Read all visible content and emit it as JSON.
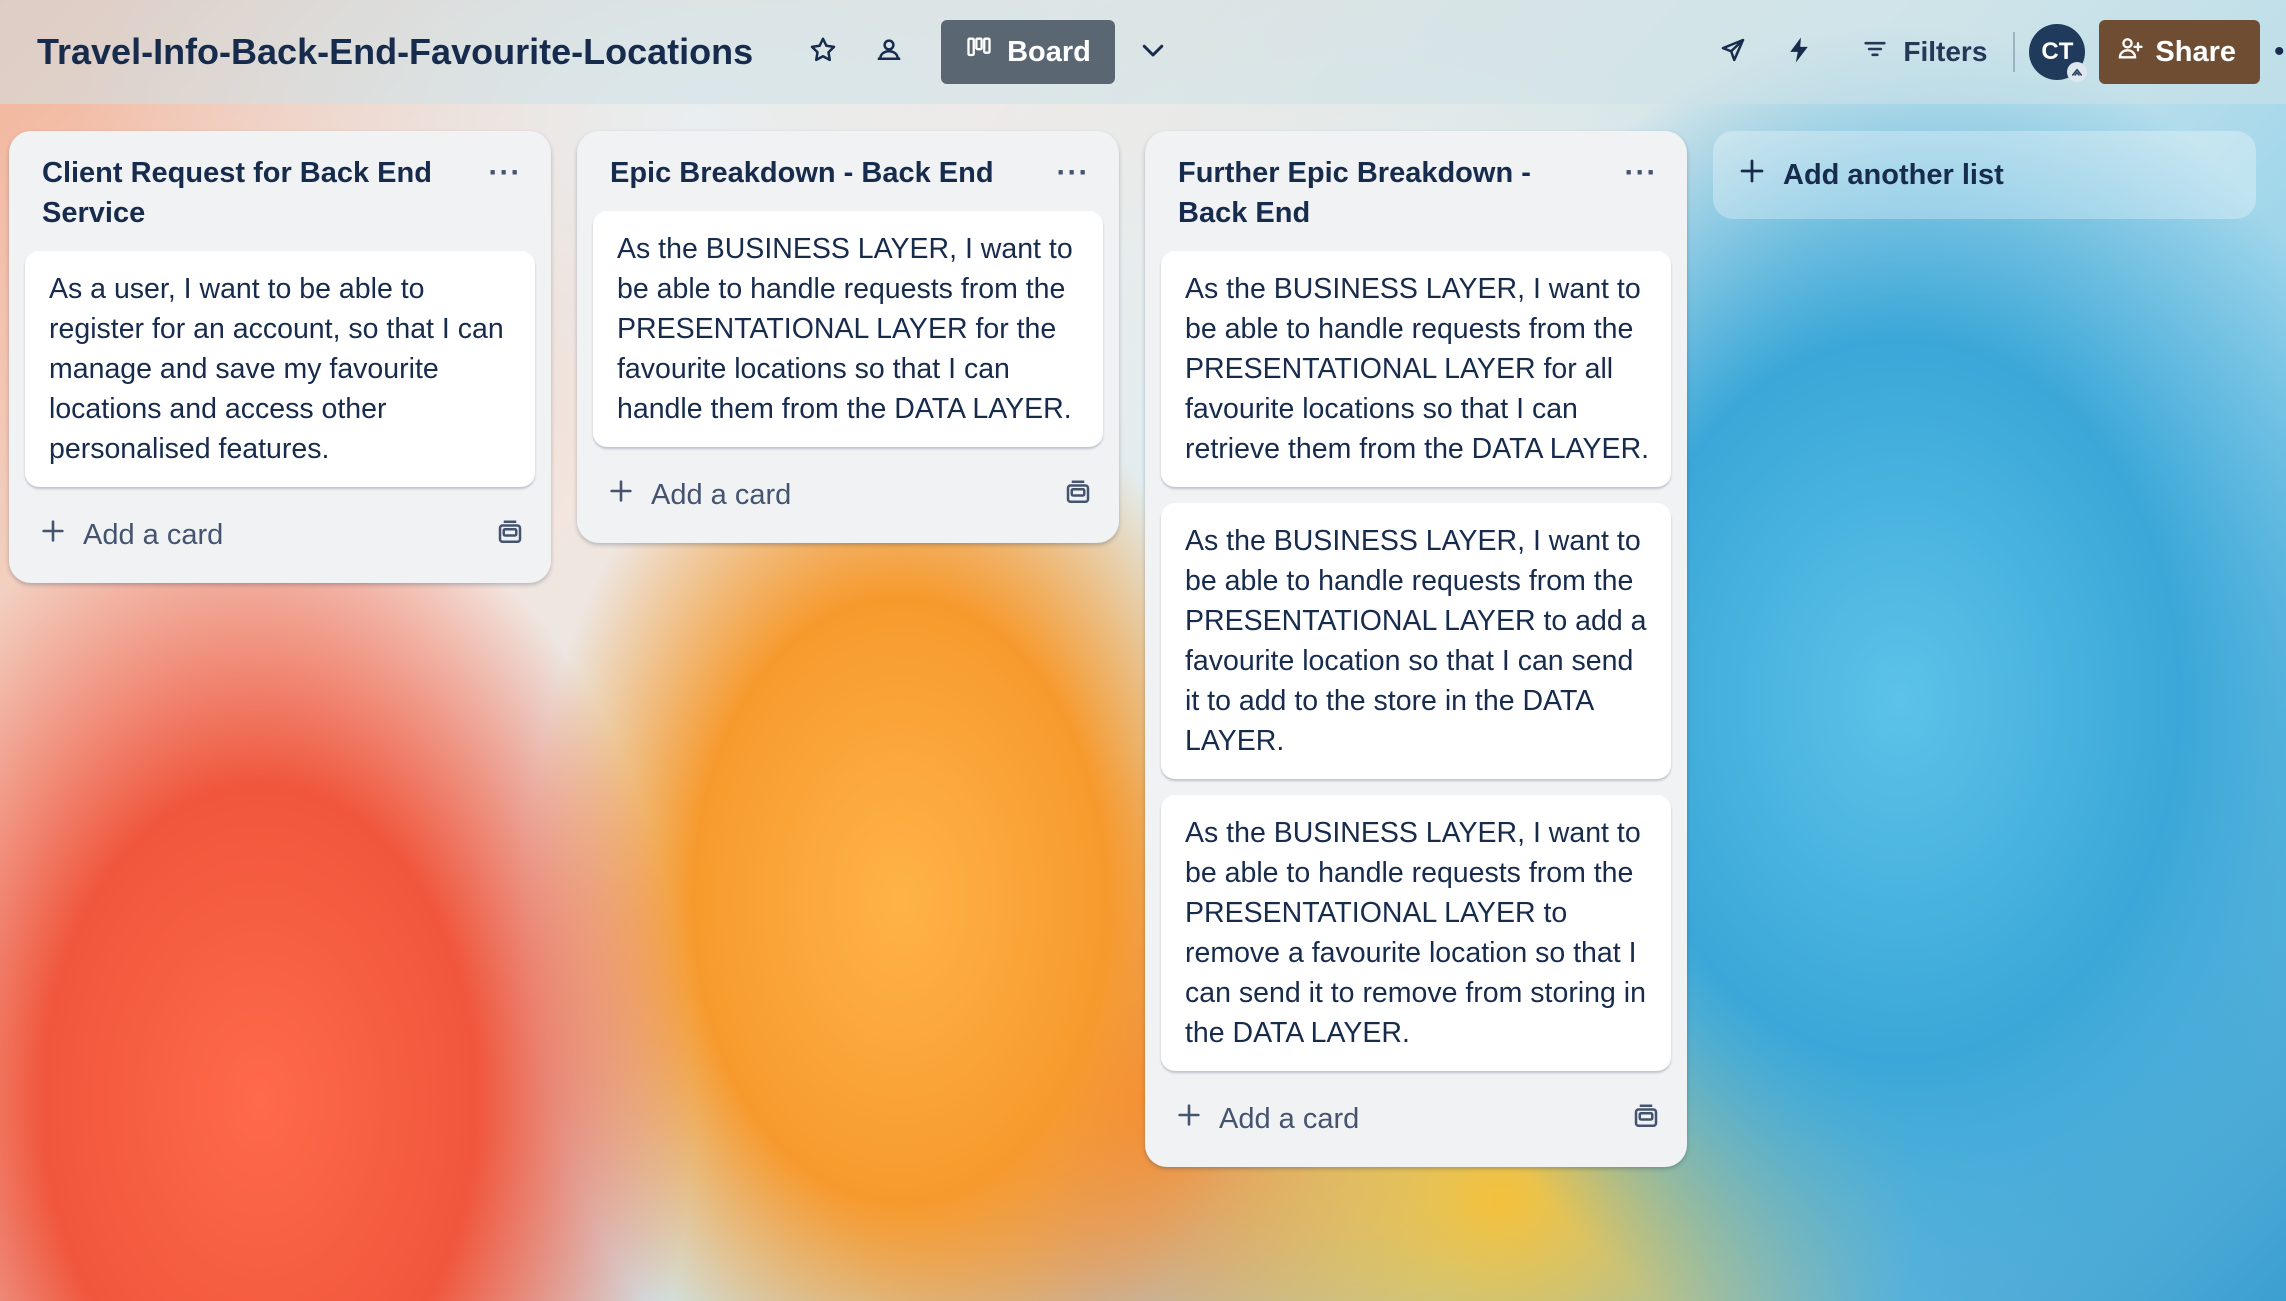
{
  "board": {
    "title": "Travel-Info-Back-End-Favourite-Locations",
    "view_label": "Board"
  },
  "header": {
    "filters_label": "Filters",
    "avatar_initials": "CT",
    "share_label": "Share",
    "more_glyph": "•"
  },
  "lists": [
    {
      "title": "Client Request for Back End Service",
      "menu_glyph": "···",
      "cards": [
        "As a user, I want to be able to register for an account, so that I can manage and save my favourite locations and access other personalised features."
      ],
      "add_card_label": "Add a card"
    },
    {
      "title": "Epic Breakdown - Back End",
      "menu_glyph": "···",
      "cards": [
        "As the BUSINESS LAYER, I want to be able to handle requests from the PRESENTATIONAL LAYER for the favourite locations so that I can handle them from the DATA LAYER."
      ],
      "add_card_label": "Add a card"
    },
    {
      "title": "Further Epic Breakdown - Back End",
      "menu_glyph": "···",
      "cards": [
        "As the BUSINESS LAYER, I want to be able to handle requests from the PRESENTATIONAL LAYER for all favourite locations so that I can retrieve them from the DATA LAYER.",
        "As the BUSINESS LAYER, I want to be able to handle requests from the PRESENTATIONAL LAYER to add a favourite location so that I can send it to add to the store in the DATA LAYER.",
        "As the BUSINESS LAYER, I want to be able to handle requests from the PRESENTATIONAL LAYER to remove a favourite location so that I can send it to remove from storing in the DATA LAYER."
      ],
      "add_card_label": "Add a card"
    }
  ],
  "add_list_label": "Add another list",
  "icons": {
    "star": "star-icon",
    "workspace": "workspace-visibility-icon",
    "board_view": "board-view-icon",
    "chevron": "chevron-down-icon",
    "power_ups": "rocket-icon",
    "automation": "lightning-icon",
    "filter": "filter-icon",
    "share": "add-person-icon",
    "list_menu": "more-horizontal-icon",
    "plus": "plus-icon",
    "template": "card-template-icon"
  },
  "colors": {
    "share_button": "#6e4d32",
    "view_button": "#5a6772",
    "avatar": "#1f3a5a",
    "list_background": "#f1f2f4",
    "text": "#172b4d"
  }
}
